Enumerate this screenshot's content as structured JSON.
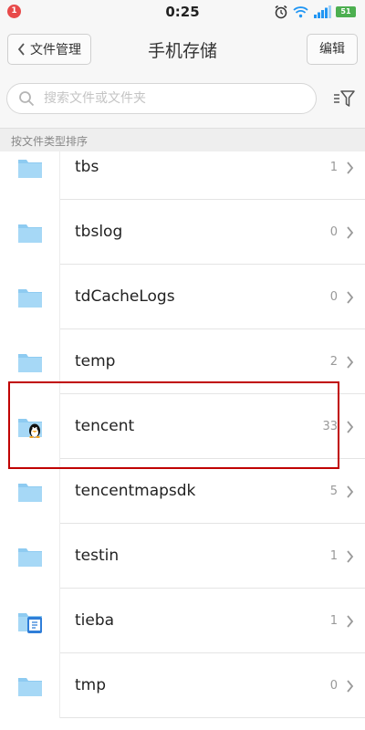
{
  "status_bar": {
    "notification_count": "1",
    "time": "0:25",
    "battery": "51",
    "icons": [
      "alarm-icon",
      "wifi-icon",
      "signal-icon",
      "battery-icon"
    ]
  },
  "header": {
    "back_label": "文件管理",
    "title": "手机存储",
    "edit_label": "编辑"
  },
  "search": {
    "placeholder": "搜索文件或文件夹"
  },
  "sort_label": "按文件类型排序",
  "files": [
    {
      "name": "tbs",
      "count": "1",
      "icon": "folder-icon"
    },
    {
      "name": "tbslog",
      "count": "0",
      "icon": "folder-icon"
    },
    {
      "name": "tdCacheLogs",
      "count": "0",
      "icon": "folder-icon"
    },
    {
      "name": "temp",
      "count": "2",
      "icon": "folder-icon"
    },
    {
      "name": "tencent",
      "count": "33",
      "icon": "qq-folder-icon"
    },
    {
      "name": "tencentmapsdk",
      "count": "5",
      "icon": "folder-icon"
    },
    {
      "name": "testin",
      "count": "1",
      "icon": "folder-icon"
    },
    {
      "name": "tieba",
      "count": "1",
      "icon": "tieba-folder-icon"
    },
    {
      "name": "tmp",
      "count": "0",
      "icon": "folder-icon"
    }
  ],
  "colors": {
    "folder": "#8ecbf1",
    "highlight": "#c00000",
    "notification": "#e84a4a",
    "battery": "#4caf50"
  }
}
